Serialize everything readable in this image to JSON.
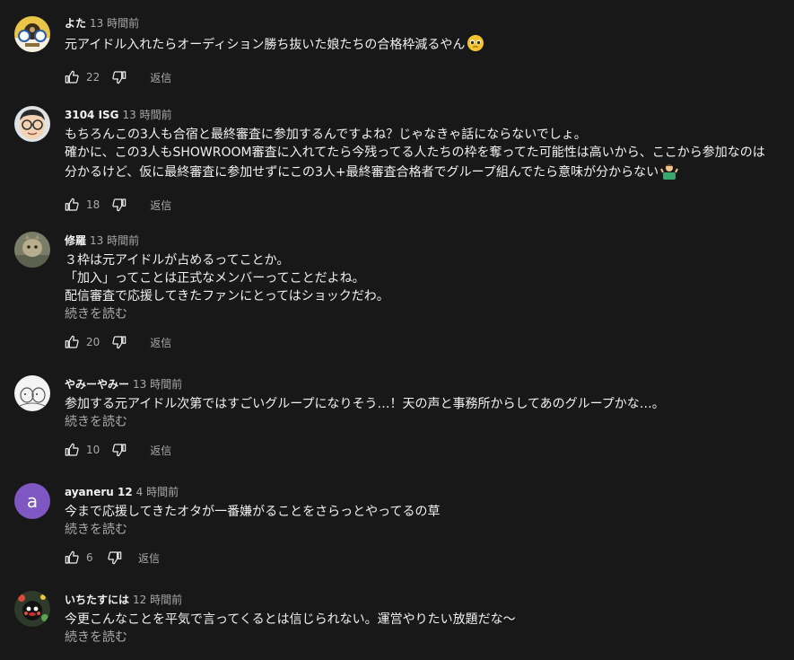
{
  "comments": [
    {
      "author": "よた",
      "time": "13 時間前",
      "text": "元アイドル入れたらオーディション勝ち抜いた娘たちの合格枠減るやん",
      "emoji": "pleading-face-emoji",
      "read_more": "",
      "likes": "22",
      "reply": "返信"
    },
    {
      "author": "3104 ISG",
      "time": "13 時間前",
      "text": "もちろんこの3人も合宿と最終審査に参加するんですよね？じゃなきゃ話にならないでしょ。\n確かに、この3人もSHOWROOM審査に入れてたら今残ってる人たちの枠を奪ってた可能性は高いから、ここから参加なのは分かるけど、仮に最終審査に参加せずにこの3人+最終審査合格者でグループ組んでたら意味が分からない",
      "emoji": "person-shrugging-emoji",
      "read_more": "",
      "likes": "18",
      "reply": "返信"
    },
    {
      "author": "修羅",
      "time": "13 時間前",
      "text": "３枠は元アイドルが占めるってことか。\n「加入」ってことは正式なメンバーってことだよね。\n配信審査で応援してきたファンにとってはショックだわ。",
      "emoji": "",
      "read_more": "続きを読む",
      "likes": "20",
      "reply": "返信"
    },
    {
      "author": "やみーやみー",
      "time": "13 時間前",
      "text": "参加する元アイドル次第ではすごいグループになりそう…！天の声と事務所からしてあのグループかな…。",
      "emoji": "",
      "read_more": "続きを読む",
      "likes": "10",
      "reply": "返信"
    },
    {
      "author": "ayaneru 12",
      "time": "4 時間前",
      "text": "今まで応援してきたオタが一番嫌がることをさらっとやってるの草",
      "emoji": "",
      "read_more": "続きを読む",
      "likes": "6",
      "reply": "返信",
      "avatar_letter": "a"
    },
    {
      "author": "いちたすには",
      "time": "12 時間前",
      "text": "今更こんなことを平気で言ってくるとは信じられない。運営やりたい放題だな～",
      "emoji": "",
      "read_more": "続きを読む",
      "likes": "",
      "reply": ""
    }
  ],
  "colors": {
    "background": "#181818",
    "text": "#f1f1f1",
    "secondary": "#aaaaaa",
    "avatar_purple": "#7e57c2"
  },
  "icons": {
    "like": "thumb-up-icon",
    "dislike": "thumb-down-icon"
  }
}
